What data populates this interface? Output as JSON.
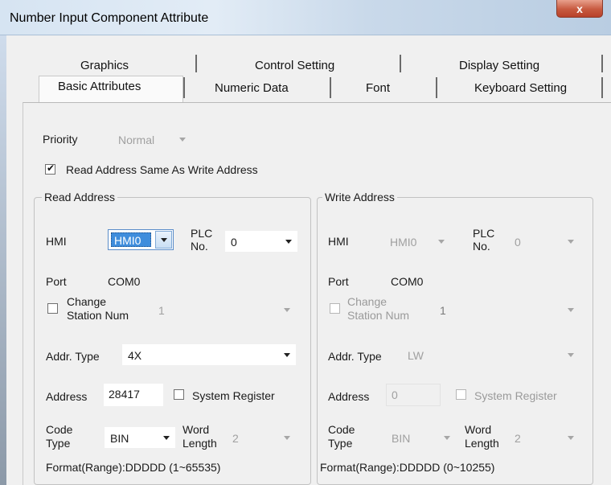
{
  "window": {
    "title": "Number Input Component Attribute",
    "close_glyph": "x"
  },
  "tabs": {
    "row1": [
      "Graphics",
      "Control Setting",
      "Display Setting"
    ],
    "row2": [
      "Basic Attributes",
      "Numeric Data",
      "Font",
      "Keyboard Setting"
    ],
    "selected": "Basic Attributes"
  },
  "priority": {
    "label": "Priority",
    "value": "Normal"
  },
  "same_address": {
    "label": "Read Address Same As Write Address",
    "checked": true,
    "check_glyph": "✔"
  },
  "read": {
    "title": "Read Address",
    "hmi_label": "HMI",
    "hmi_value": "HMI0",
    "plc_label_1": "PLC",
    "plc_label_2": "No.",
    "plc_value": "0",
    "port_label": "Port",
    "port_value": "COM0",
    "station_label_1": "Change",
    "station_label_2": "Station Num",
    "station_value": "1",
    "addr_type_label": "Addr. Type",
    "addr_type_value": "4X",
    "address_label": "Address",
    "address_value": "28417",
    "sysreg_label": "System Register",
    "code_label_1": "Code",
    "code_label_2": "Type",
    "code_value": "BIN",
    "word_label_1": "Word",
    "word_label_2": "Length",
    "word_value": "2",
    "format": "Format(Range):DDDDD (1~65535)"
  },
  "write": {
    "title": "Write Address",
    "hmi_label": "HMI",
    "hmi_value": "HMI0",
    "plc_label_1": "PLC",
    "plc_label_2": "No.",
    "plc_value": "0",
    "port_label": "Port",
    "port_value": "COM0",
    "station_label_1": "Change",
    "station_label_2": "Station Num",
    "station_value": "1",
    "addr_type_label": "Addr. Type",
    "addr_type_value": "LW",
    "address_label": "Address",
    "address_value": "0",
    "sysreg_label": "System Register",
    "code_label_1": "Code",
    "code_label_2": "Type",
    "code_value": "BIN",
    "word_label_1": "Word",
    "word_label_2": "Length",
    "word_value": "2",
    "format": "Format(Range):DDDDD (0~10255)"
  }
}
